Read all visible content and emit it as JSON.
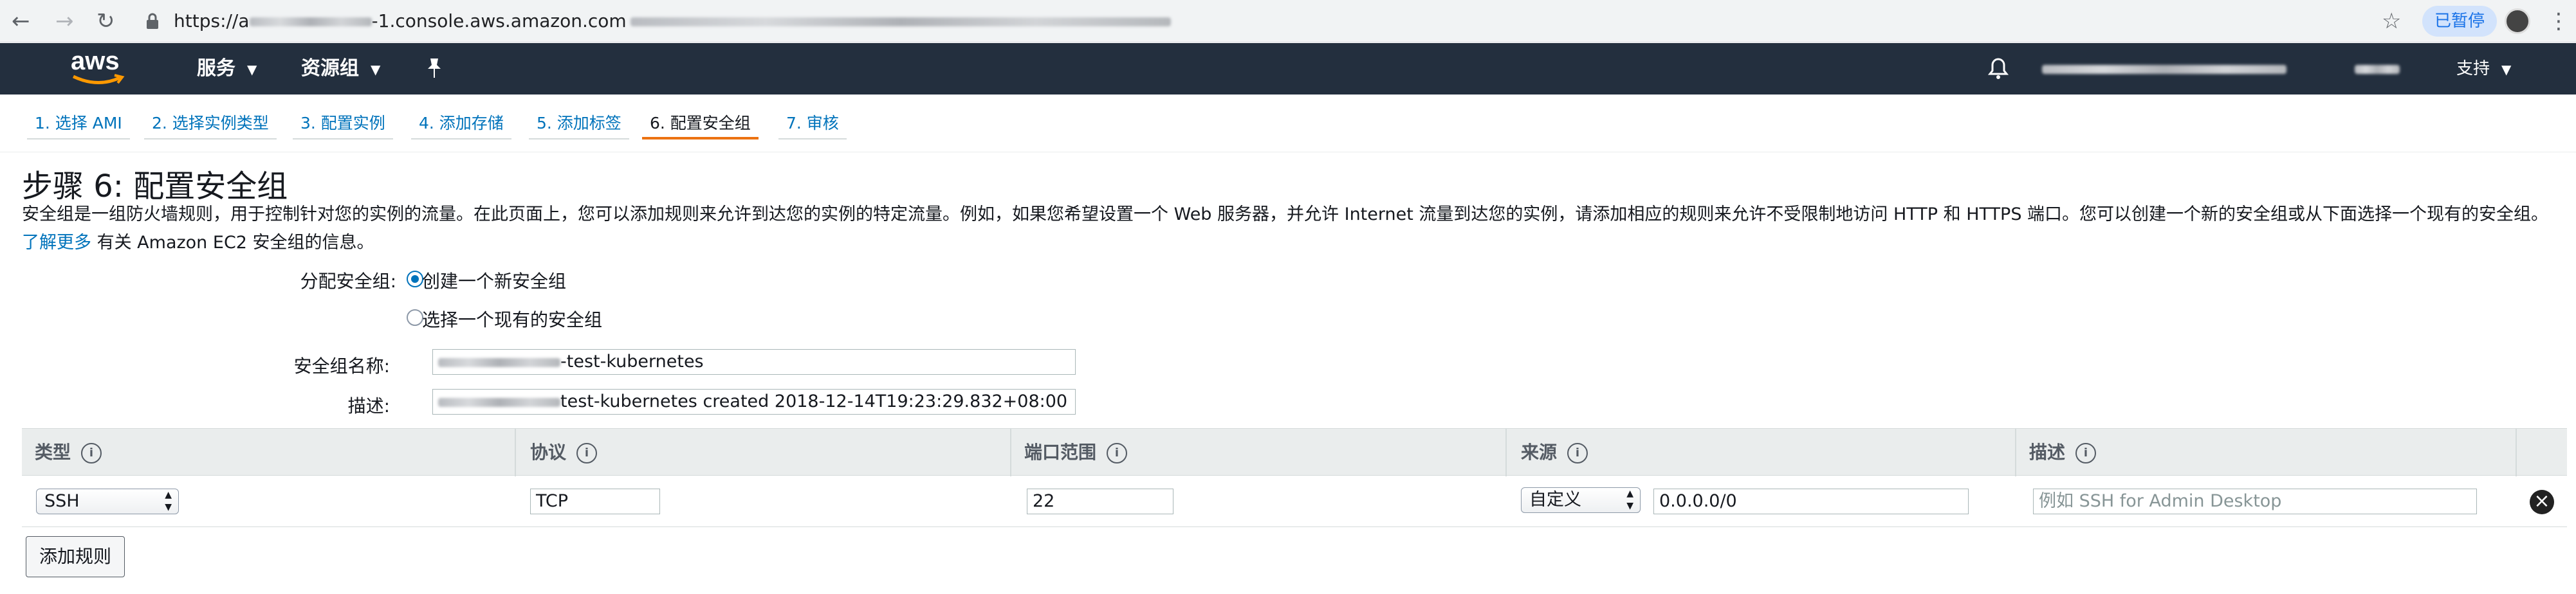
{
  "browser": {
    "url_prefix": "https://a",
    "url_visible": "-1.console.aws.amazon.com",
    "paused_label": "已暂停"
  },
  "aws_nav": {
    "logo_text": "aws",
    "services_label": "服务",
    "resource_groups_label": "资源组",
    "support_label": "支持"
  },
  "wizard": {
    "tabs": [
      {
        "label": "1. 选择 AMI"
      },
      {
        "label": "2. 选择实例类型"
      },
      {
        "label": "3. 配置实例"
      },
      {
        "label": "4. 添加存储"
      },
      {
        "label": "5. 添加标签"
      },
      {
        "label": "6. 配置安全组"
      },
      {
        "label": "7. 审核"
      }
    ],
    "active_index": 5
  },
  "page": {
    "title": "步骤 6: 配置安全组",
    "intro": "安全组是一组防火墙规则，用于控制针对您的实例的流量。在此页面上，您可以添加规则来允许到达您的实例的特定流量。例如，如果您希望设置一个 Web 服务器，并允许 Internet 流量到达您的实例，请添加相应的规则来允许不受限制地访问 HTTP 和 HTTPS 端口。您可以创建一个新的安全组或从下面选择一个现有的安全组。",
    "learn_more_link": "了解更多",
    "learn_more_suffix": "有关 Amazon EC2 安全组的信息。"
  },
  "form": {
    "assign_label": "分配安全组:",
    "option_create": "创建一个新安全组",
    "option_existing": "选择一个现有的安全组",
    "selected_option": "create",
    "name_label": "安全组名称:",
    "name_value_suffix": "-test-kubernetes",
    "desc_label": "描述:",
    "desc_value_suffix": "test-kubernetes created 2018-12-14T19:23:29.832+08:00"
  },
  "rules_table": {
    "columns": [
      "类型",
      "协议",
      "端口范围",
      "来源",
      "描述"
    ],
    "rows": [
      {
        "type": "SSH",
        "protocol": "TCP",
        "port_range": "22",
        "source_mode": "自定义",
        "source_cidr": "0.0.0.0/0",
        "description_placeholder": "例如 SSH for Admin Desktop"
      }
    ],
    "add_rule_label": "添加规则"
  }
}
